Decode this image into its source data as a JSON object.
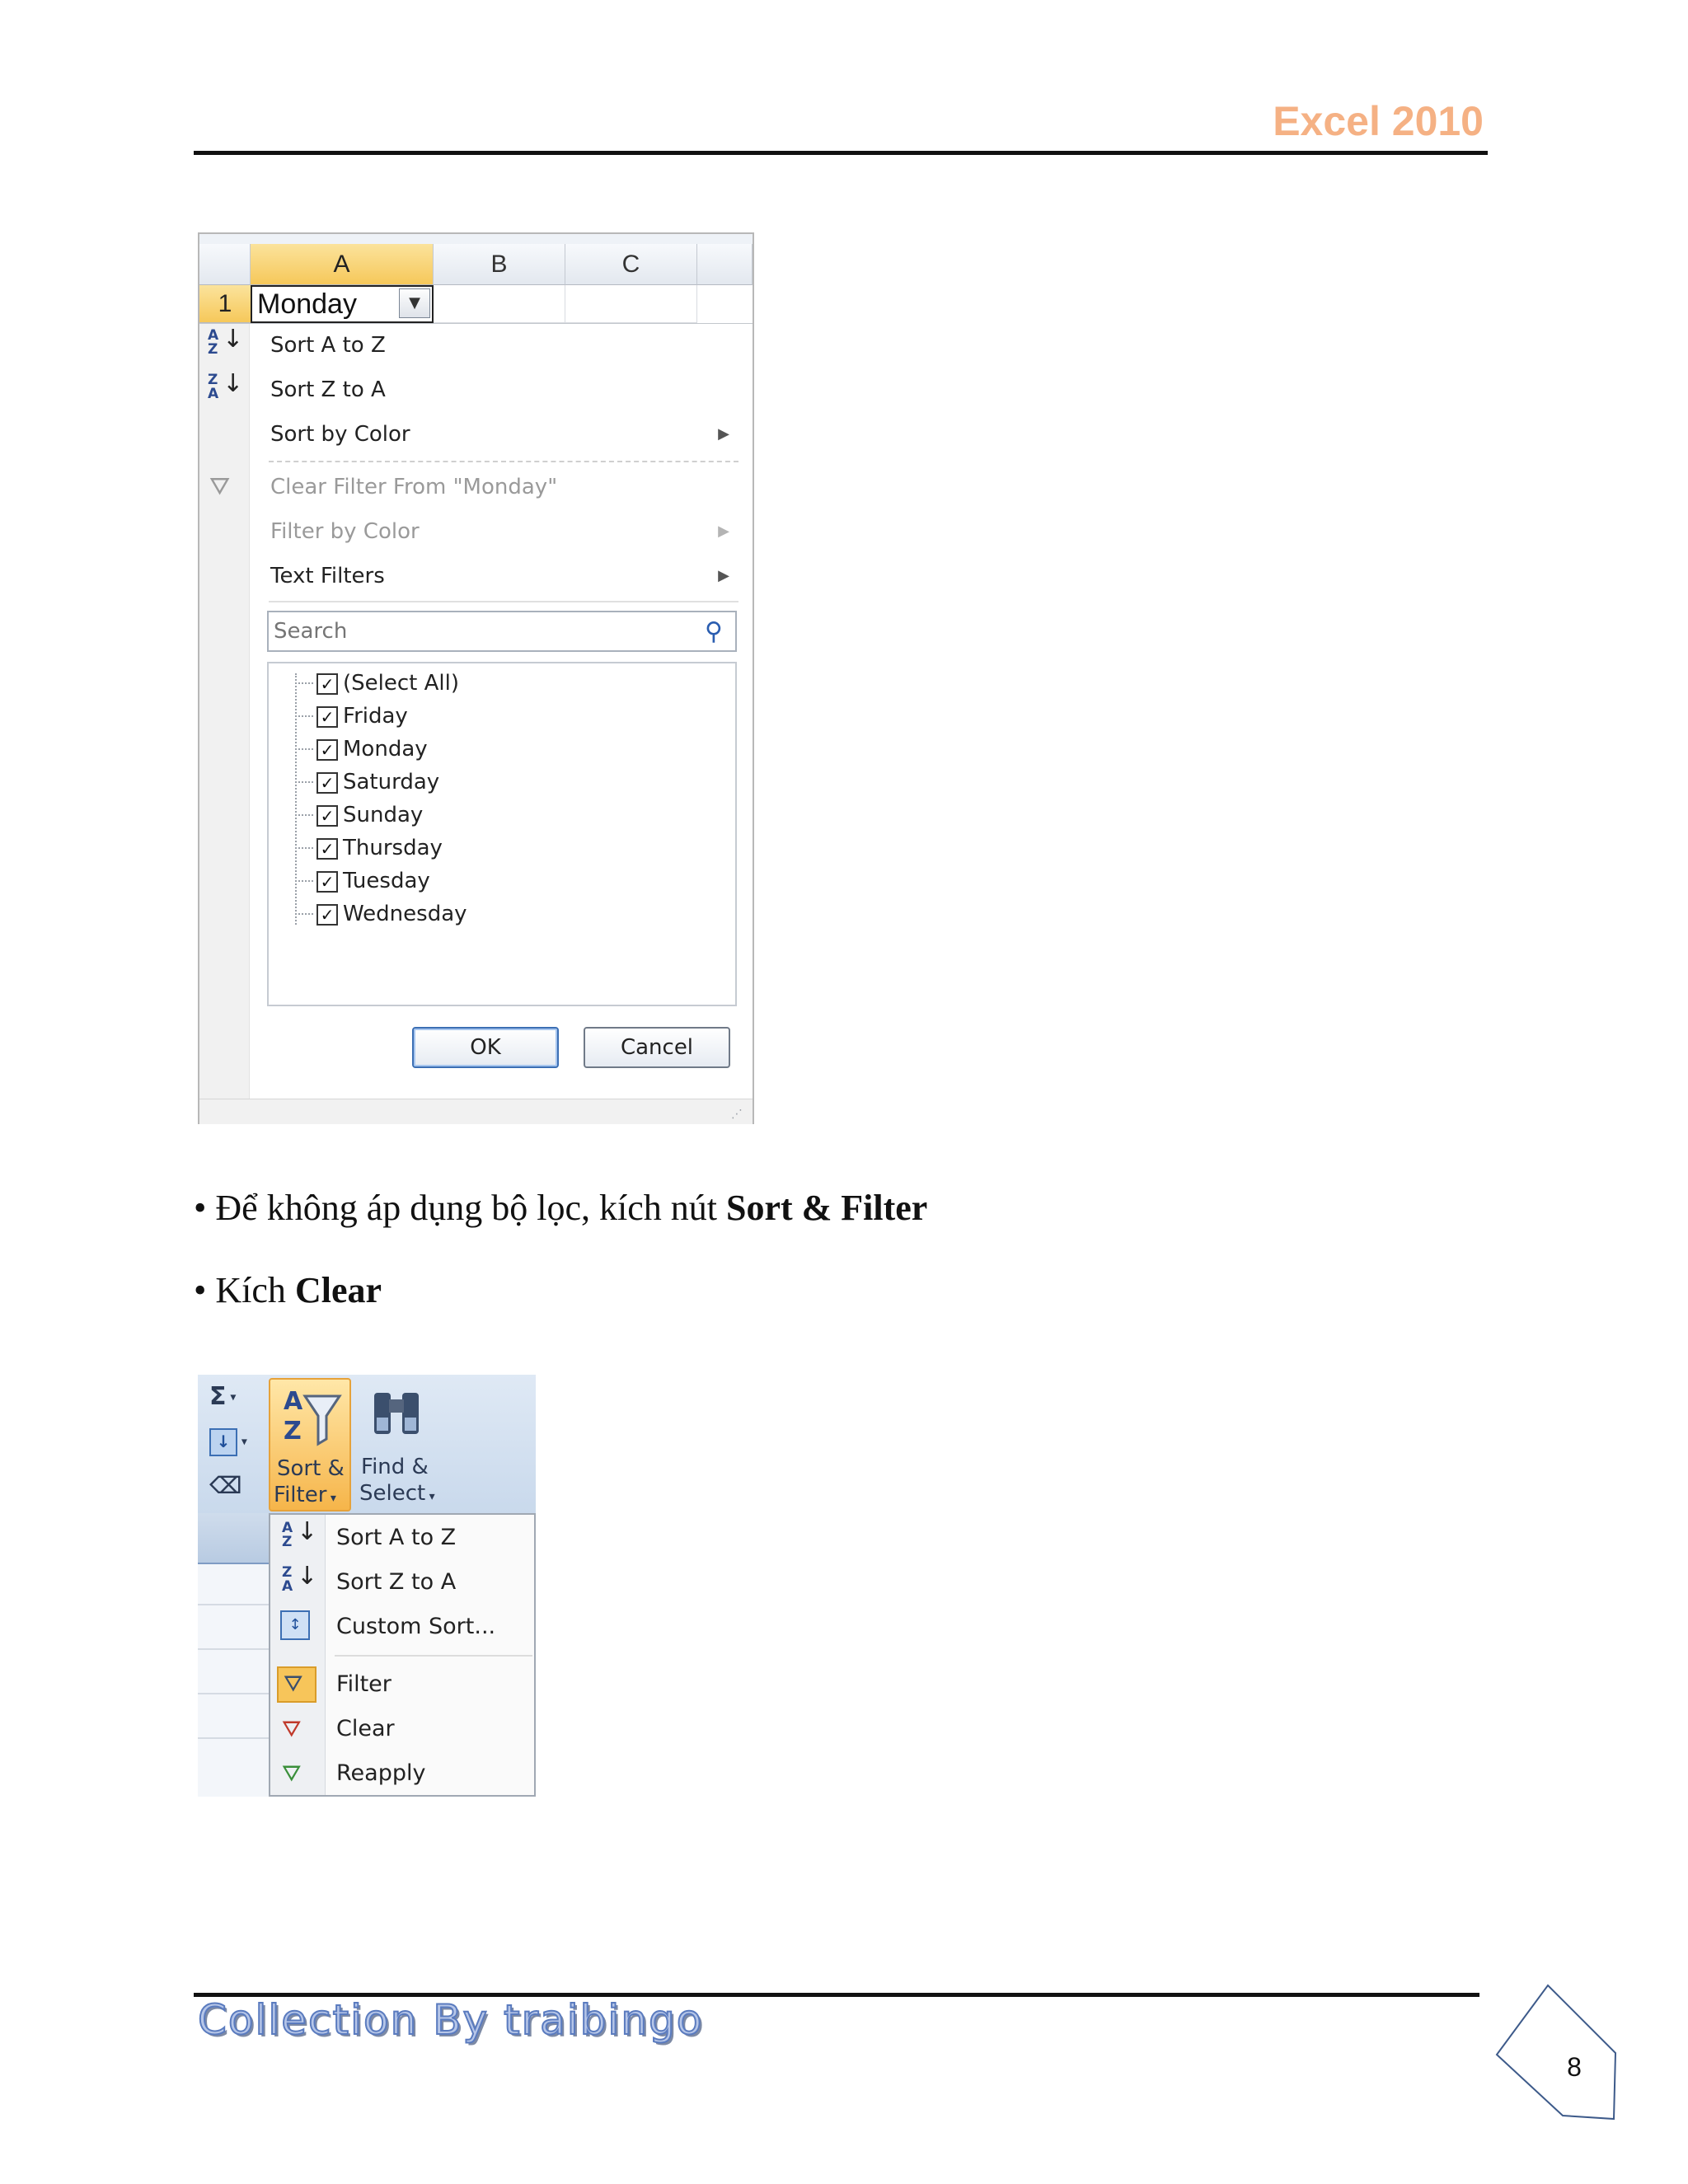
{
  "header": {
    "title": "Excel 2010"
  },
  "filter_dropdown": {
    "columns": [
      "A",
      "B",
      "C"
    ],
    "row_number": "1",
    "cell_a1": "Monday",
    "menu": [
      {
        "label": "Sort A to Z",
        "icon": "sort-a-to-z-icon",
        "enabled": true
      },
      {
        "label": "Sort Z to A",
        "icon": "sort-z-to-a-icon",
        "enabled": true
      },
      {
        "label": "Sort by Color",
        "enabled": true,
        "submenu": true
      },
      {
        "label": "Clear Filter From \"Monday\"",
        "icon": "clear-filter-icon",
        "enabled": false
      },
      {
        "label": "Filter by Color",
        "enabled": false,
        "submenu": true
      },
      {
        "label": "Text Filters",
        "enabled": true,
        "submenu": true
      }
    ],
    "search_placeholder": "Search",
    "list": [
      {
        "label": "(Select All)",
        "checked": true
      },
      {
        "label": "Friday",
        "checked": true
      },
      {
        "label": "Monday",
        "checked": true
      },
      {
        "label": "Saturday",
        "checked": true
      },
      {
        "label": "Sunday",
        "checked": true
      },
      {
        "label": "Thursday",
        "checked": true
      },
      {
        "label": "Tuesday",
        "checked": true
      },
      {
        "label": "Wednesday",
        "checked": true
      }
    ],
    "ok_label": "OK",
    "cancel_label": "Cancel"
  },
  "body": {
    "bullet1_prefix": "• Để không áp dụng bộ lọc, kích nút ",
    "bullet1_bold": "Sort & Filter",
    "bullet2_prefix": "• Kích ",
    "bullet2_bold": "Clear"
  },
  "ribbon": {
    "sort_filter_line1": "Sort &",
    "sort_filter_line2": "Filter",
    "find_select_line1": "Find &",
    "find_select_line2": "Select",
    "sum_glyph": "Σ",
    "menu": [
      {
        "label": "Sort A to Z",
        "icon": "sort-a-to-z-icon"
      },
      {
        "label": "Sort Z to A",
        "icon": "sort-z-to-a-icon"
      },
      {
        "label": "Custom Sort...",
        "icon": "custom-sort-icon"
      },
      {
        "label": "Filter",
        "icon": "filter-icon"
      },
      {
        "label": "Clear",
        "icon": "clear-filter-icon"
      },
      {
        "label": "Reapply",
        "icon": "reapply-filter-icon"
      }
    ]
  },
  "footer": {
    "brand": "Collection By traibingo",
    "page_number": "8"
  },
  "colors": {
    "header_accent": "#f5b184",
    "selected_header": "#f6c85a",
    "ribbon_highlight": "#f6b54a",
    "brand_blue": "#5a7bbf"
  }
}
